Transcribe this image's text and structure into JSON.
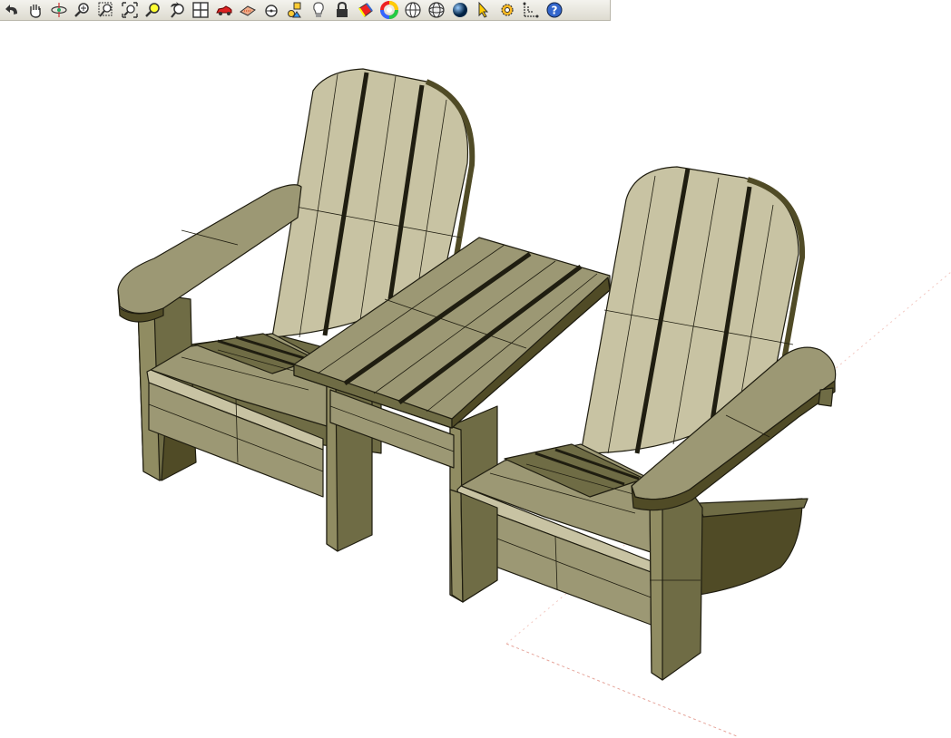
{
  "app": {
    "type": "3D modeling viewport"
  },
  "toolbar": {
    "tools": [
      {
        "id": "undo",
        "icon": "undo-icon"
      },
      {
        "id": "pan",
        "icon": "pan-hand-icon"
      },
      {
        "id": "orbit",
        "icon": "orbit-icon"
      },
      {
        "id": "zoom",
        "icon": "zoom-icon"
      },
      {
        "id": "zoom-window",
        "icon": "zoom-window-icon"
      },
      {
        "id": "zoom-extents",
        "icon": "zoom-extents-icon"
      },
      {
        "id": "zoom-selected",
        "icon": "zoom-selected-icon"
      },
      {
        "id": "previous-view",
        "icon": "previous-view-icon"
      },
      {
        "id": "views",
        "icon": "grid-views-icon"
      },
      {
        "id": "walk",
        "icon": "car-icon"
      },
      {
        "id": "section",
        "icon": "section-plane-icon"
      },
      {
        "id": "tape",
        "icon": "tape-measure-icon"
      },
      {
        "id": "shapes",
        "icon": "shapes-icon"
      },
      {
        "id": "light",
        "icon": "light-bulb-icon"
      },
      {
        "id": "lock",
        "icon": "lock-icon"
      },
      {
        "id": "paint",
        "icon": "paint-bucket-icon"
      },
      {
        "id": "color-wheel",
        "icon": "color-wheel-icon"
      },
      {
        "id": "sphere-wire",
        "icon": "wireframe-sphere-icon"
      },
      {
        "id": "sphere-grid",
        "icon": "grid-sphere-icon"
      },
      {
        "id": "sphere-shaded",
        "icon": "shaded-sphere-icon"
      },
      {
        "id": "cursor",
        "icon": "select-arrow-icon"
      },
      {
        "id": "settings",
        "icon": "gear-icon"
      },
      {
        "id": "dimension",
        "icon": "dimension-icon"
      },
      {
        "id": "help",
        "icon": "help-icon"
      }
    ]
  },
  "model": {
    "subject": "adirondack-double-chair",
    "colors": {
      "top": "#9c9874",
      "back": "#c8c3a3",
      "shade": "#6f6c45",
      "dark": "#504b26",
      "edge": "#1f1d10",
      "axis": "#e6a59b"
    }
  }
}
